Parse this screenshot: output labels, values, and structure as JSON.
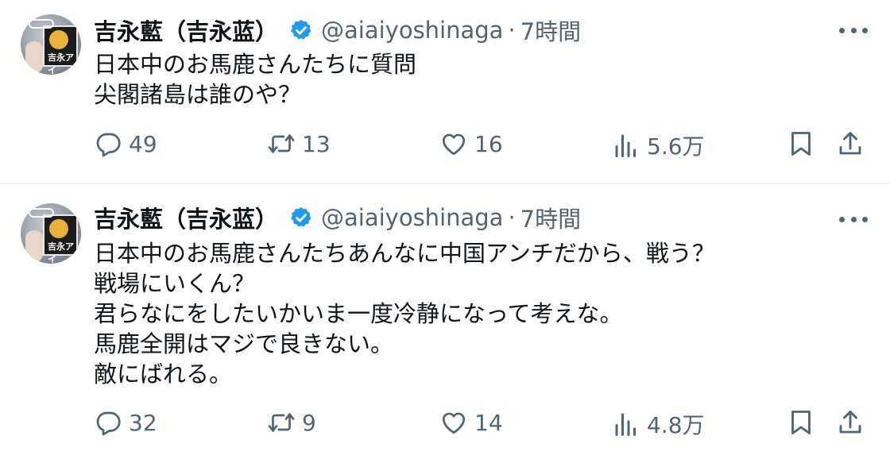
{
  "tweets": [
    {
      "author": {
        "name": "吉永藍（吉永蓝）",
        "handle": "@aiaiyoshinaga",
        "separator": "·",
        "time": "7時間",
        "verified": true,
        "avatar_sign_text": "吉永アイ"
      },
      "lines": [
        "日本中のお馬鹿さんたちに質問",
        "尖閣諸島は誰のや？"
      ],
      "stats": {
        "replies": "49",
        "retweets": "13",
        "likes": "16",
        "views": "5.6万"
      }
    },
    {
      "author": {
        "name": "吉永藍（吉永蓝）",
        "handle": "@aiaiyoshinaga",
        "separator": "·",
        "time": "7時間",
        "verified": true,
        "avatar_sign_text": "吉永アイ"
      },
      "lines": [
        "日本中のお馬鹿さんたちあんなに中国アンチだから、戦う？",
        "戦場にいくん？",
        "君らなにをしたいかいま一度冷静になって考えな。",
        "馬鹿全開はマジで良きない。",
        "敵にばれる。"
      ],
      "stats": {
        "replies": "32",
        "retweets": "9",
        "likes": "14",
        "views": "4.8万"
      }
    }
  ],
  "colors": {
    "text": "#0f1419",
    "secondary": "#536471",
    "verified": "#1d9bf0",
    "divider": "#eff3f4"
  },
  "icons": [
    "reply-icon",
    "retweet-icon",
    "like-icon",
    "views-icon",
    "bookmark-icon",
    "share-icon",
    "more-icon",
    "verified-badge-icon"
  ]
}
